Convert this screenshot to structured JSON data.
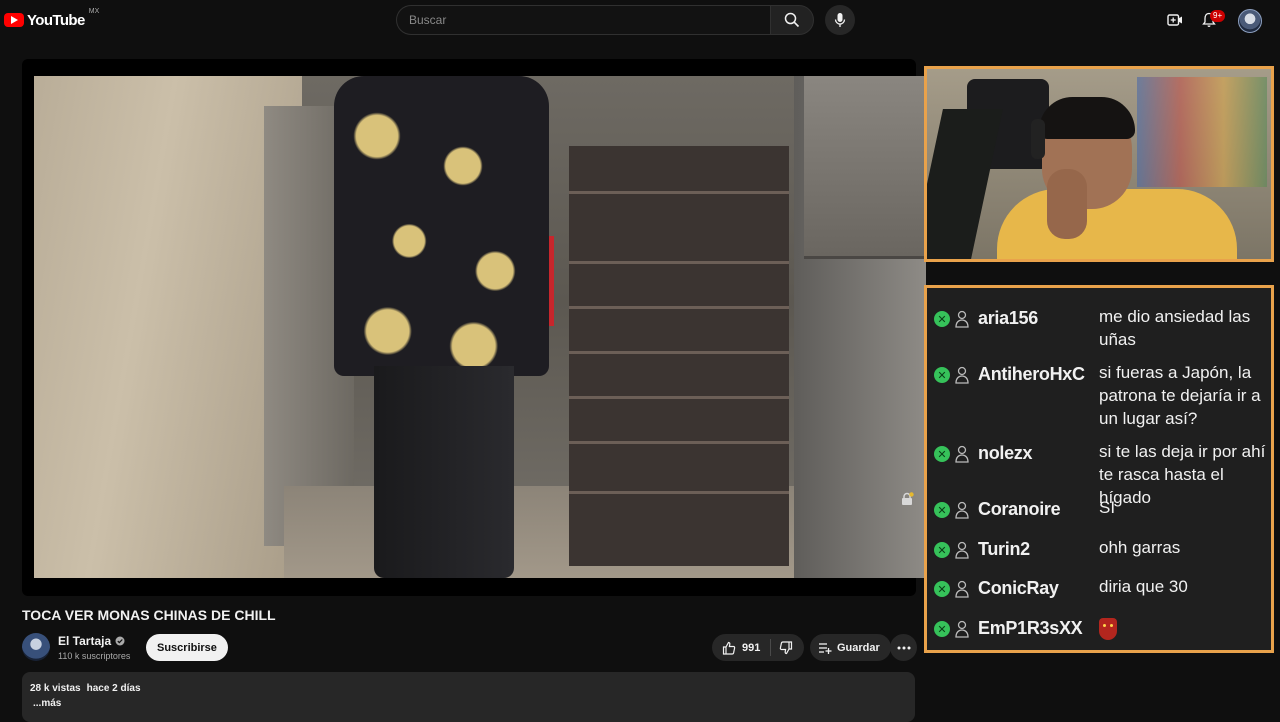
{
  "topbar": {
    "logo_text": "YouTube",
    "logo_region": "MX",
    "search_placeholder": "Buscar",
    "notification_count": "9+"
  },
  "video": {
    "title": "TOCA VER MONAS CHINAS DE CHILL",
    "channel": {
      "name": "El Tartaja",
      "subscribers": "110 k suscriptores",
      "verified": true
    },
    "subscribe_label": "Suscribirse",
    "likes": "991",
    "save_label": "Guardar",
    "description": {
      "views": "28 k vistas",
      "date": "hace 2 días",
      "more": "...más"
    }
  },
  "chat": {
    "accent_color": "#e9a24b",
    "badge_color": "#36c25a",
    "messages": [
      {
        "user": "aria156",
        "text": "me dio ansiedad las uñas"
      },
      {
        "user": "AntiheroHxC",
        "text": "si fueras a Japón, la patrona te dejaría ir a un lugar así?"
      },
      {
        "user": "nolezx",
        "text": "si te las deja ir por ahí te rasca hasta el hígado"
      },
      {
        "user": "Coranoire",
        "text": "SI"
      },
      {
        "user": "Turin2",
        "text": "ohh garras"
      },
      {
        "user": "ConicRay",
        "text": "diria que 30"
      },
      {
        "user": "EmP1R3sXX",
        "text": "",
        "emote": "red-mask-emote"
      }
    ]
  }
}
